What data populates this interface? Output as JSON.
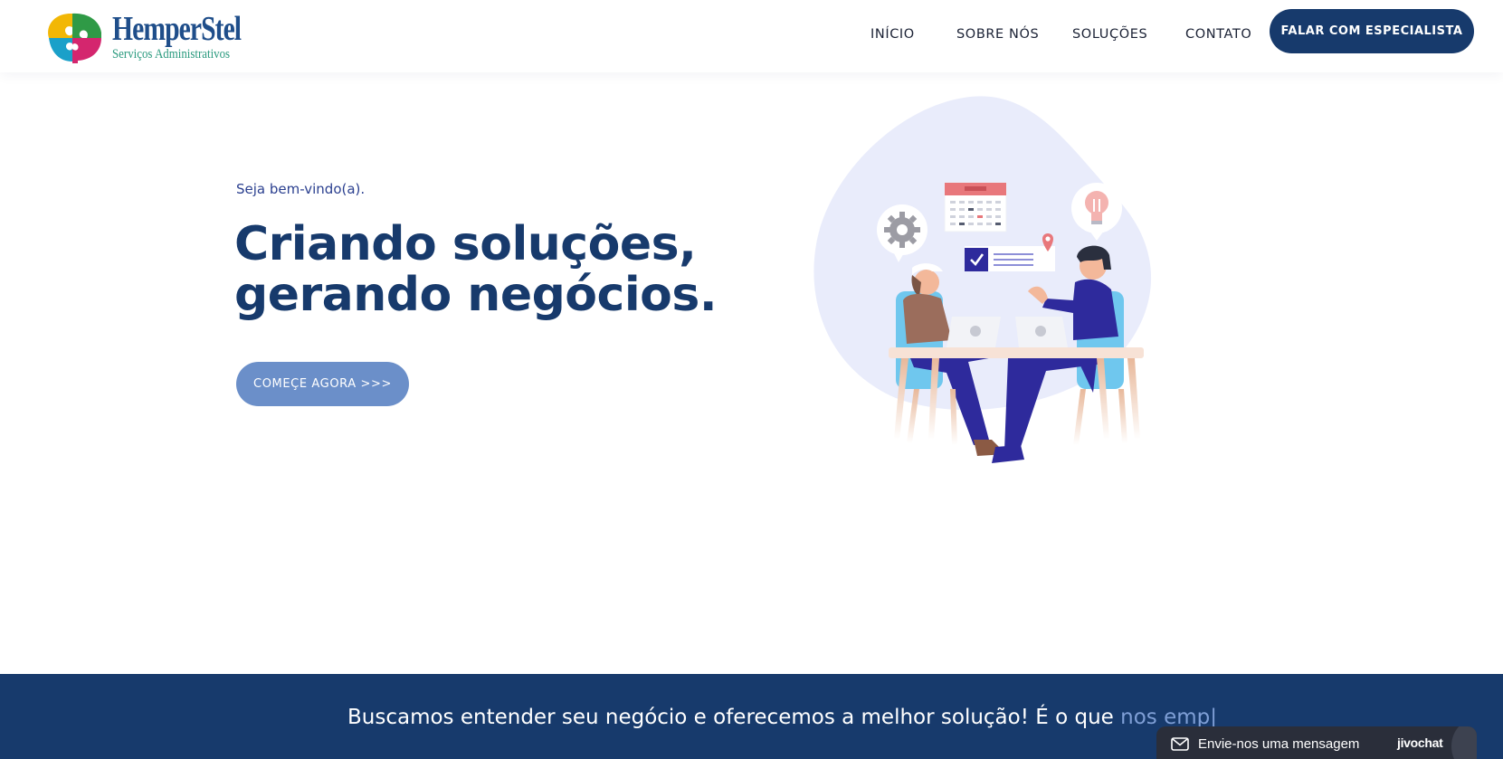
{
  "brand": {
    "name": "HemperStel",
    "tagline": "Serviços Administrativos"
  },
  "nav": {
    "items": [
      {
        "label": "INÍCIO"
      },
      {
        "label": "SOBRE NÓS"
      },
      {
        "label": "SOLUÇÕES"
      },
      {
        "label": "CONTATO"
      }
    ],
    "cta_label": "FALAR COM ESPECIALISTA"
  },
  "hero": {
    "welcome": "Seja bem-vindo(a).",
    "headline_line1": "Criando soluções,",
    "headline_line2": "gerando negócios.",
    "button_label": "COMEÇE AGORA >>>"
  },
  "band": {
    "text_main": "Buscamos entender seu negócio e oferecemos a melhor solução! É o que ",
    "text_highlight": "nos emp|"
  },
  "chat": {
    "label": "Envie-nos uma mensagem",
    "brand": "jivochat"
  },
  "colors": {
    "primary": "#173a6c",
    "button_light": "#6b8fc9",
    "accent_text": "#2a3f8f",
    "highlight": "#7f9fd6",
    "chat_bg": "#2a2e3a"
  },
  "icons": [
    "logo-mark-icon",
    "gear-icon",
    "calendar-icon",
    "lightbulb-icon",
    "location-pin-icon",
    "checkbox-icon",
    "mail-icon"
  ]
}
